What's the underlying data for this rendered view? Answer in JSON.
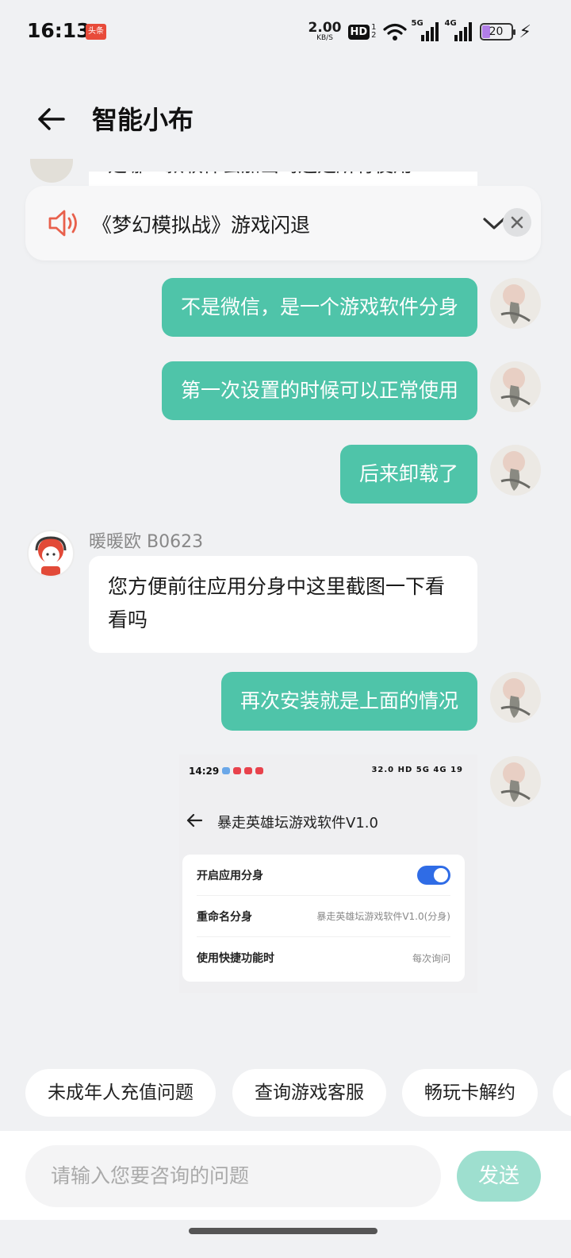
{
  "status_bar": {
    "time": "16:13",
    "app_badge": "头条",
    "net_speed_value": "2.00",
    "net_speed_unit": "KB/S",
    "hd_label": "HD",
    "hd_sub": [
      "1",
      "2"
    ],
    "signal_1_tag": "5G",
    "signal_2_tag": "4G",
    "battery_level": "20"
  },
  "header": {
    "title": "智能小布"
  },
  "partial_message": {
    "text": "是哪一款软件会加出吗还是所有使用"
  },
  "topic": {
    "text": "《梦幻模拟战》游戏闪退"
  },
  "messages": {
    "out_1": "不是微信，是一个游戏软件分身",
    "out_2": "第一次设置的时候可以正常使用",
    "out_3": "后来卸载了",
    "agent_name": "暖暖欧 B0623",
    "in_1": "您方便前往应用分身中这里截图一下看看吗",
    "out_4": "再次安装就是上面的情况"
  },
  "screenshot": {
    "time": "14:29",
    "status_right": "32.0 HD 5G 4G 19",
    "title": "暴走英雄坛游戏软件V1.0",
    "rows": [
      {
        "label": "开启应用分身",
        "value": ""
      },
      {
        "label": "重命名分身",
        "value": "暴走英雄坛游戏软件V1.0(分身)"
      },
      {
        "label": "使用快捷功能时",
        "value": "每次询问"
      }
    ],
    "toggle_on": true
  },
  "quick_replies": [
    "未成年人充值问题",
    "查询游戏客服",
    "畅玩卡解约"
  ],
  "input": {
    "placeholder": "请输入您要咨询的问题",
    "send_label": "发送"
  },
  "colors": {
    "accent": "#4fc4a9",
    "send_disabled": "#9edfcf",
    "speaker": "#e8604c",
    "toggle": "#2f6ce6"
  }
}
